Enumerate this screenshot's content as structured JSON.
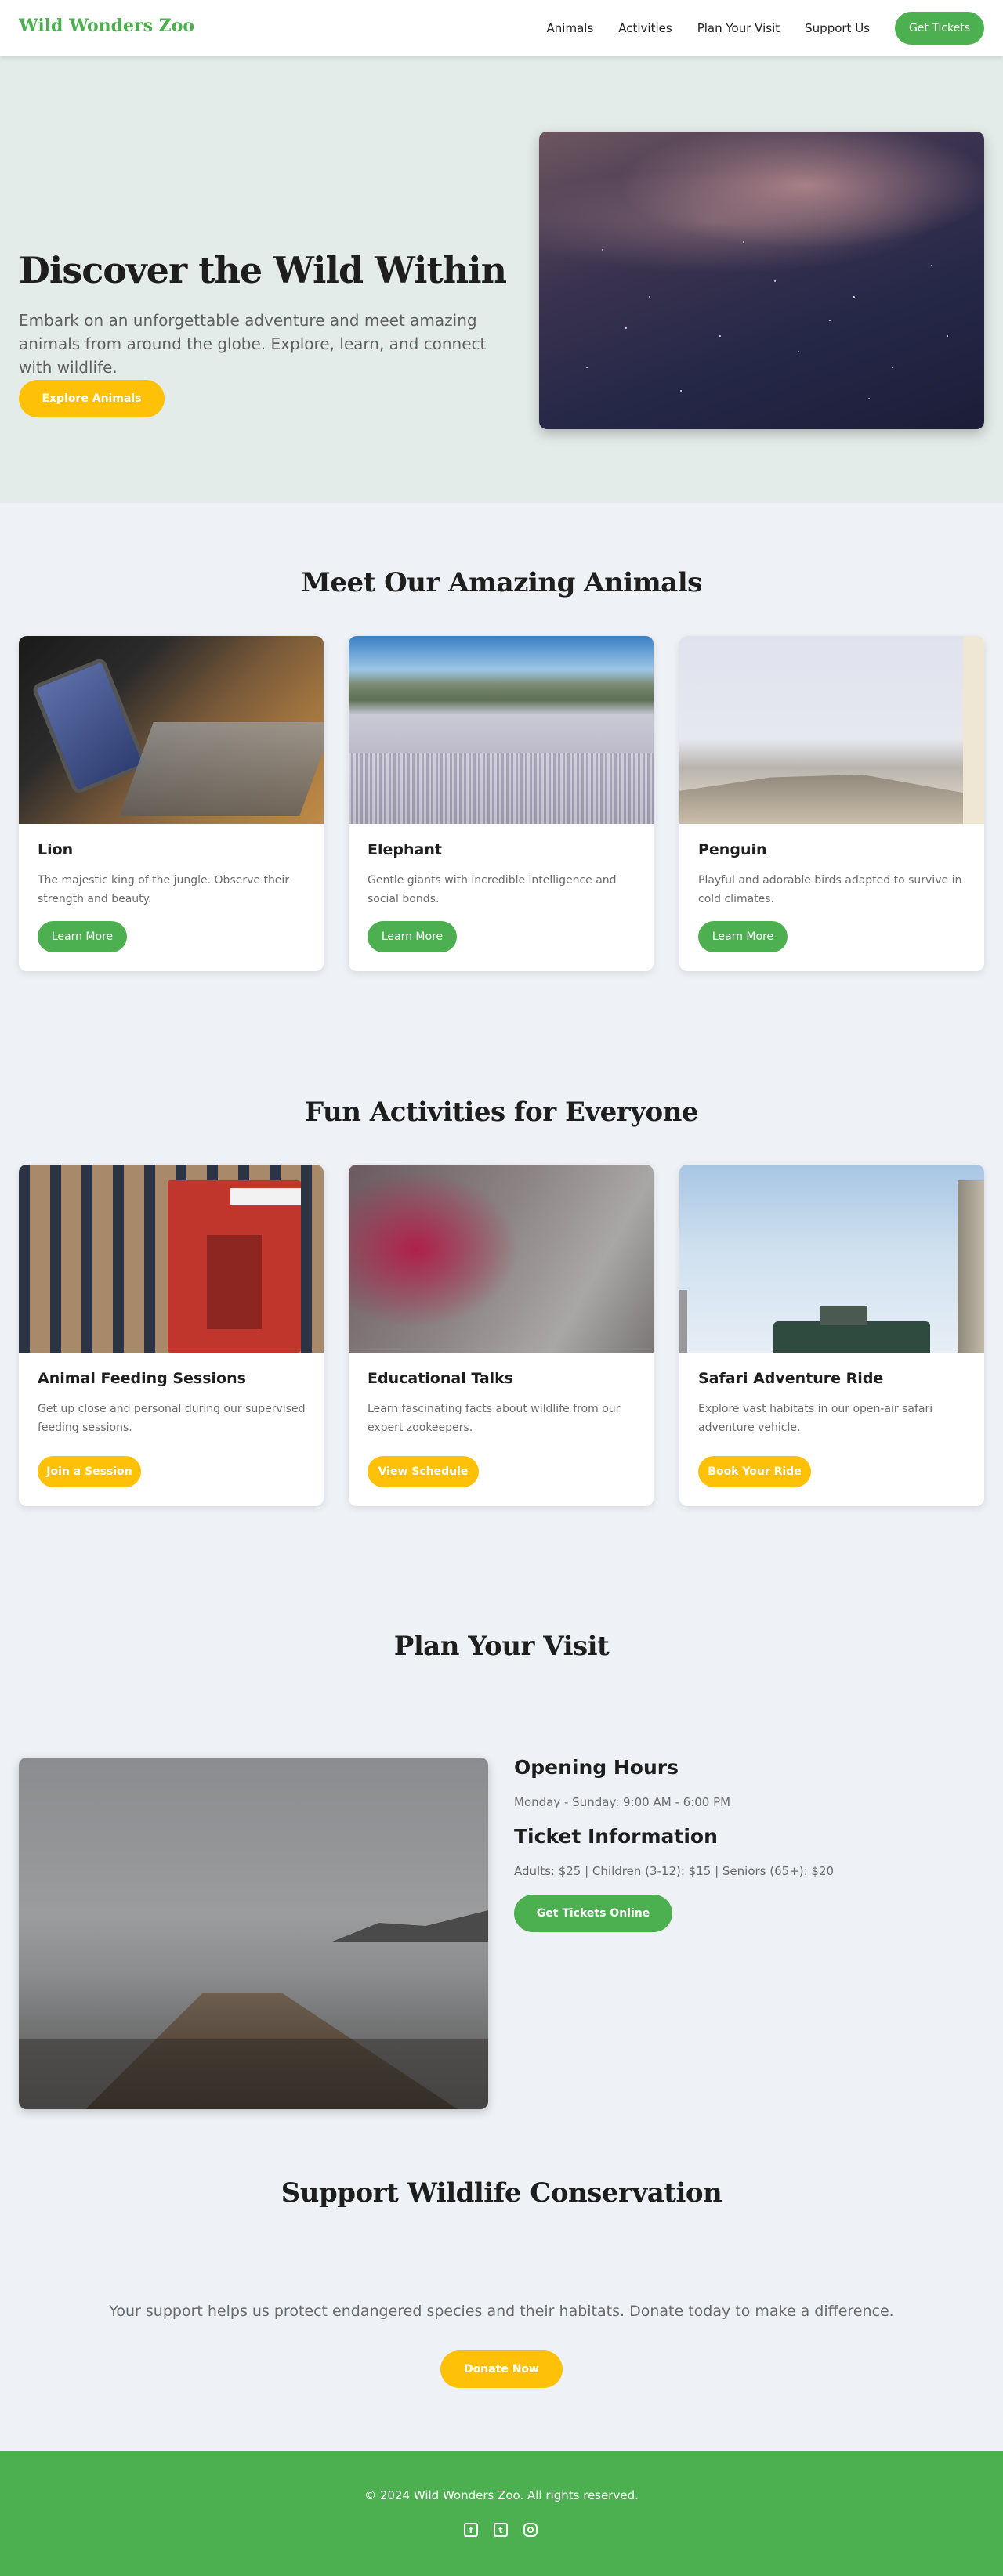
{
  "brand": "Wild Wonders Zoo",
  "nav": {
    "links": [
      "Animals",
      "Activities",
      "Plan Your Visit",
      "Support Us"
    ],
    "cta": "Get Tickets"
  },
  "hero": {
    "title": "Discover the Wild Within",
    "subtitle": "Embark on an unforgettable adventure and meet amazing animals from around the globe. Explore, learn, and connect with wildlife.",
    "button": "Explore Animals"
  },
  "animals": {
    "title": "Meet Our Amazing Animals",
    "cards": [
      {
        "title": "Lion",
        "description": "The majestic king of the jungle. Observe their strength and beauty.",
        "button": "Learn More"
      },
      {
        "title": "Elephant",
        "description": "Gentle giants with incredible intelligence and social bonds.",
        "button": "Learn More"
      },
      {
        "title": "Penguin",
        "description": "Playful and adorable birds adapted to survive in cold climates.",
        "button": "Learn More"
      }
    ]
  },
  "activities": {
    "title": "Fun Activities for Everyone",
    "cards": [
      {
        "title": "Animal Feeding Sessions",
        "description": "Get up close and personal during our supervised feeding sessions.",
        "button": "Join a Session"
      },
      {
        "title": "Educational Talks",
        "description": "Learn fascinating facts about wildlife from our expert zookeepers.",
        "button": "View Schedule"
      },
      {
        "title": "Safari Adventure Ride",
        "description": "Explore vast habitats in our open-air safari adventure vehicle.",
        "button": "Book Your Ride"
      }
    ]
  },
  "visit": {
    "title": "Plan Your Visit",
    "hours_heading": "Opening Hours",
    "hours": "Monday - Sunday: 9:00 AM - 6:00 PM",
    "tickets_heading": "Ticket Information",
    "tickets": "Adults: $25 | Children (3-12): $15 | Seniors (65+): $20",
    "button": "Get Tickets Online"
  },
  "support": {
    "title": "Support Wildlife Conservation",
    "text": "Your support helps us protect endangered species and their habitats. Donate today to make a difference.",
    "button": "Donate Now"
  },
  "footer": {
    "copyright": "© 2024 Wild Wonders Zoo. All rights reserved.",
    "social_icons": [
      "facebook-icon",
      "twitter-icon",
      "instagram-icon"
    ]
  },
  "colors": {
    "primary_green": "#4caf50",
    "accent_yellow": "#ffc107",
    "page_background": "#eef2f6",
    "hero_background": "#e4ece9"
  }
}
